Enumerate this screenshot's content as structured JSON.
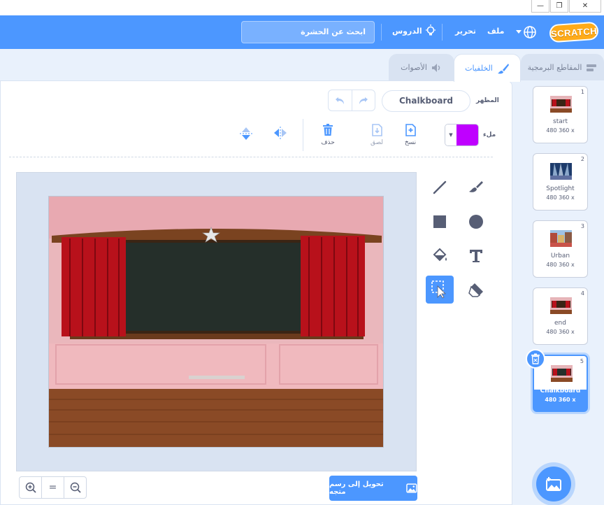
{
  "menubar": {
    "logo": "SCRATCH",
    "file": "ملف",
    "edit": "تحرير",
    "tutorials": "الدروس",
    "search": "ابحث عن الحشرة"
  },
  "tabs": {
    "code": "المقاطع البرمجية",
    "backdrops": "الخلفيات",
    "sounds": "الأصوات"
  },
  "editor": {
    "costume_label": "المظهر",
    "costume_name": "Chalkboard",
    "fill_label": "ملء",
    "fill_color": "#bf00ff",
    "copy_label": "نسخ",
    "paste_label": "لصق",
    "delete_label": "حذف",
    "convert_button": "تحويل إلى رسم متجه",
    "zoom_reset": "="
  },
  "backdrops": [
    {
      "num": "1",
      "name": "start",
      "size": "480 360 x"
    },
    {
      "num": "2",
      "name": "Spotlight",
      "size": "480 360 x"
    },
    {
      "num": "3",
      "name": "Urban",
      "size": "480 360 x"
    },
    {
      "num": "4",
      "name": "end",
      "size": "480 360 x"
    },
    {
      "num": "5",
      "name": "Chalkboard",
      "size": "480 360 x"
    }
  ],
  "colors": {
    "accent": "#4c97ff",
    "logo": "#ffab19"
  }
}
